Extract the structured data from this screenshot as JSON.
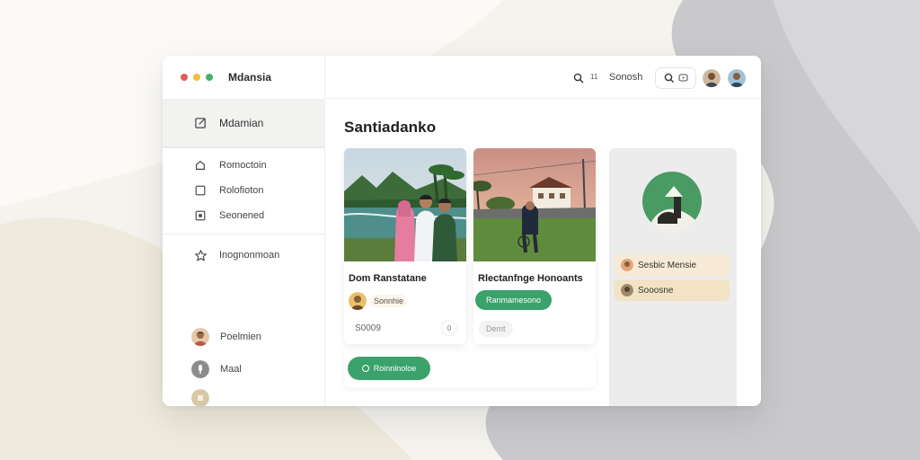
{
  "window": {
    "app_title": "Mdansia",
    "traffic_colors": [
      "#e25c5c",
      "#f2bf3d",
      "#45b36b"
    ]
  },
  "sidebar": {
    "active_item": {
      "label": "Mdamian",
      "icon": "edit-icon"
    },
    "items": [
      {
        "label": "Romoctoin",
        "icon": "home-icon"
      },
      {
        "label": "Rolofioton",
        "icon": "square-icon"
      },
      {
        "label": "Seonened",
        "icon": "frame-icon"
      }
    ],
    "extra_item": {
      "label": "Inognonmoan",
      "icon": "star-icon"
    },
    "users": [
      {
        "label": "Poelmien",
        "avatar": "woman-avatar"
      },
      {
        "label": "Maal",
        "avatar": "mic-icon"
      },
      {
        "label": "",
        "avatar": "small-avatar"
      }
    ]
  },
  "header": {
    "small_label": "11",
    "search_label": "Sonosh",
    "accent": "#3aa26a"
  },
  "main": {
    "title": "Santiadanko",
    "cards": [
      {
        "title": "Dom Ranstatane",
        "user_chip": "Sonnhie",
        "footer_text": "S0009",
        "footer_btn": "0"
      },
      {
        "title": "Rlectanfnge Honoants",
        "green_tag": "Ranmamesono",
        "grey_tag": "Demt"
      }
    ],
    "bottom_button": "Roinnlnoloe"
  },
  "right_panel": {
    "rows": [
      {
        "label": "Sesbic Mensie",
        "bg": "#f7ead6"
      },
      {
        "label": "Sooosne",
        "bg": "#f2e3c4"
      }
    ]
  }
}
